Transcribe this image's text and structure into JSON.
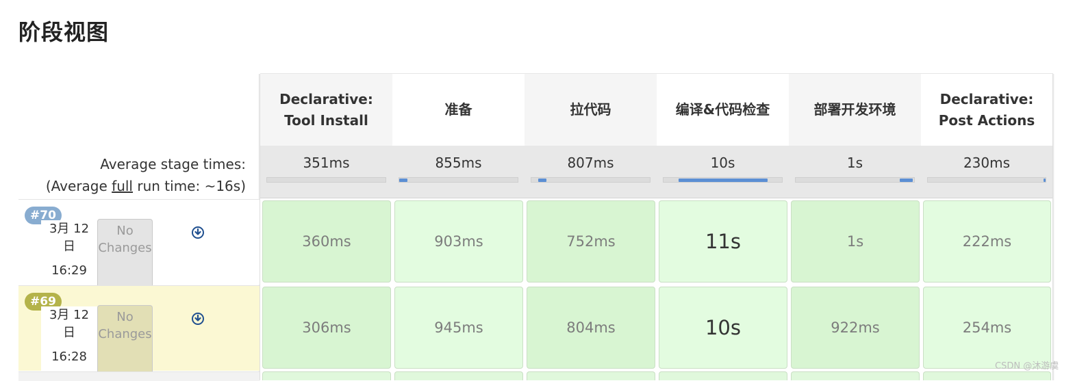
{
  "page_title": "阶段视图",
  "stages": [
    {
      "name_line1": "Declarative:",
      "name_line2": "Tool Install",
      "avg": "351ms",
      "avg_bar": {
        "start": 0.0,
        "end": 0.0
      }
    },
    {
      "name_line1": "准备",
      "name_line2": "",
      "avg": "855ms",
      "avg_bar": {
        "start": 0.0,
        "end": 0.07
      }
    },
    {
      "name_line1": "拉代码",
      "name_line2": "",
      "avg": "807ms",
      "avg_bar": {
        "start": 0.06,
        "end": 0.13
      }
    },
    {
      "name_line1": "编译&代码检查",
      "name_line2": "",
      "avg": "10s",
      "avg_bar": {
        "start": 0.13,
        "end": 0.88
      }
    },
    {
      "name_line1": "部署开发环境",
      "name_line2": "",
      "avg": "1s",
      "avg_bar": {
        "start": 0.88,
        "end": 0.99
      }
    },
    {
      "name_line1": "Declarative:",
      "name_line2": "Post Actions",
      "avg": "230ms",
      "avg_bar": {
        "start": 0.98,
        "end": 1.0
      }
    }
  ],
  "averages": {
    "line1": "Average stage times:",
    "line2_prefix": "(Average ",
    "line2_link": "full",
    "line2_suffix": " run time: ~16s)"
  },
  "builds": [
    {
      "number": "#70",
      "date_line1": "3月 12",
      "date_line2": "日",
      "time": "16:29",
      "changes_line1": "No",
      "changes_line2": "Changes",
      "icon": "download-circle-icon",
      "durations": [
        "360ms",
        "903ms",
        "752ms",
        "11s",
        "1s",
        "222ms"
      ]
    },
    {
      "number": "#69",
      "date_line1": "3月 12",
      "date_line2": "日",
      "time": "16:28",
      "changes_line1": "No",
      "changes_line2": "Changes",
      "icon": "download-circle-icon",
      "durations": [
        "306ms",
        "945ms",
        "804ms",
        "10s",
        "922ms",
        "254ms"
      ]
    }
  ],
  "colors": {
    "badge_70": "#88acd0",
    "badge_69": "#b4b34a",
    "success_cell": "#e3fce0",
    "highlight_row": "#fbf8d3",
    "progress_bar": "#5b8fd4"
  },
  "watermark": "CSDN @沐游虞"
}
